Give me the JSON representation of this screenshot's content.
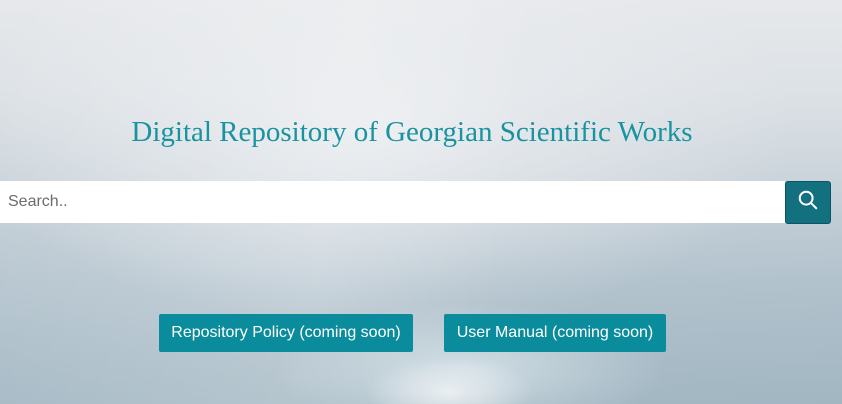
{
  "header": {
    "title": "Digital Repository of Georgian Scientific Works"
  },
  "search": {
    "placeholder": "Search..",
    "value": "",
    "button_icon": "search-icon"
  },
  "actions": {
    "policy_label": "Repository Policy (coming soon)",
    "manual_label": "User Manual (coming soon)"
  },
  "colors": {
    "title": "#1a93a0",
    "search_button": "#13707f",
    "action_button": "#0b8c9c"
  }
}
